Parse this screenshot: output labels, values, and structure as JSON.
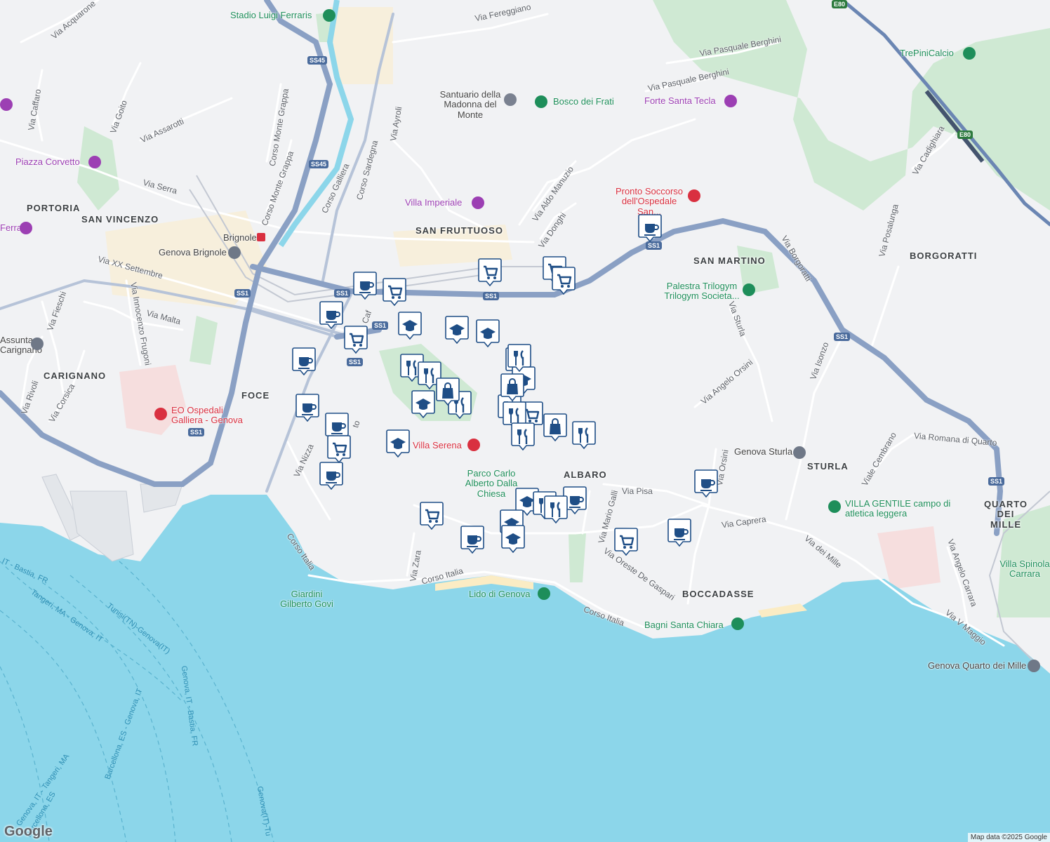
{
  "map": {
    "attribution": "Map data ©2025 Google",
    "logo": "Google",
    "colors": {
      "sea": "#8cd6ea",
      "land": "#f1f2f4",
      "park": "#c7e8cd",
      "highway": "#7f97bd",
      "road": "#ffffff",
      "pin": "#1f4e86",
      "rail": "#b9c0cc",
      "beach": "#fbecc4"
    }
  },
  "districts": [
    "PORTORIA",
    "SAN VINCENZO",
    "CARIGNANO",
    "FOCE",
    "SAN FRUTTUOSO",
    "SAN MARTINO",
    "ALBARO",
    "STURLA",
    "BORGORATTI",
    "QUARTO DEI MILLE",
    "BOCCADASSE"
  ],
  "streets": [
    "Via Acquarone",
    "Via Caffaro",
    "Via Goito",
    "Via Assarotti",
    "Corso Monte Grappa",
    "Corso Monte Grappa",
    "Via Serra",
    "Via XX Settembre",
    "Via Malta",
    "Via Fieschi",
    "Via Innocenzo Frugoni",
    "Via Rivoli",
    "Via Corsica",
    "Corso Galliera",
    "Corso Sardegna",
    "Via Ayroli",
    "Via Fereggiano",
    "Via Pasquale Berghini",
    "Via Pasquale Berghini",
    "Via Aldo Manuzio",
    "Via Donghi",
    "Via Cadighiara",
    "Via Borgoratti",
    "Via Posalunga",
    "Via Sturla",
    "Via Isonzo",
    "Via Angelo Orsini",
    "Via Romana di Quarto",
    "Viale Cembrano",
    "Via Nizza",
    "Via Pisa",
    "Via Mario Galli",
    "Via Caprera",
    "Via dei Mille",
    "Via Angelo Carrara",
    "Via V Maggio",
    "Corso Italia",
    "Corso Italia",
    "Via Oreste De Gaspari",
    "Corso Italia",
    "Via Zara",
    "Via Caf",
    "to",
    "Via Orsini"
  ],
  "pois": [
    "Stadio Luigi Ferraris",
    "Piazza Corvetto",
    "Santuario della Madonna del Monte",
    "Bosco dei Frati",
    "Forte Santa Tecla",
    "TrePiniCalcio",
    "Villa Imperiale",
    "Pronto Soccorso dell'Ospedale San...",
    "Palestra Trilogym Trilogym Societa...",
    "Genova Brignole",
    "Brignole",
    "EO Ospedali Galliera - Genova",
    "Villa Serena",
    "Parco Carlo Alberto Dalla Chiesa",
    "Genova Sturla",
    "VILLA GENTILE campo di atletica leggera",
    "Villa Spinola Carrara",
    "Lido di Genova",
    "Bagni Santa Chiara",
    "Giardini Gilberto Govi",
    "Genova Quarto dei Mille",
    "Assunta Carignano",
    "Ferrari"
  ],
  "route_labels": [
    "Tangeri, MA - Genova, IT",
    "Tunisi(TN)-Genova(IT)",
    "Genova, IT - Bastia, FR",
    "Barcellona, ES - Genova, IT",
    "Genova(IT)-Tu",
    "Genova, IT - Tangeri, MA",
    "IT - Bastia, FR",
    "Barcellona, ES"
  ],
  "road_shields": [
    "SS45",
    "SS45",
    "SS1",
    "SS1",
    "SS1",
    "SS1",
    "SS1",
    "SS1",
    "SS1",
    "SS1",
    "SS1",
    "E80",
    "E80"
  ],
  "pins": [
    {
      "kind": "cafe"
    },
    {
      "kind": "cafe"
    },
    {
      "kind": "cafe"
    },
    {
      "kind": "cafe"
    },
    {
      "kind": "cafe"
    },
    {
      "kind": "cafe"
    },
    {
      "kind": "cafe"
    },
    {
      "kind": "cafe"
    },
    {
      "kind": "cafe"
    },
    {
      "kind": "cafe"
    },
    {
      "kind": "cafe"
    },
    {
      "kind": "grocery"
    },
    {
      "kind": "grocery"
    },
    {
      "kind": "grocery"
    },
    {
      "kind": "grocery"
    },
    {
      "kind": "grocery"
    },
    {
      "kind": "grocery"
    },
    {
      "kind": "grocery"
    },
    {
      "kind": "grocery"
    },
    {
      "kind": "grocery"
    },
    {
      "kind": "grocery"
    },
    {
      "kind": "school"
    },
    {
      "kind": "school"
    },
    {
      "kind": "school"
    },
    {
      "kind": "school"
    },
    {
      "kind": "school"
    },
    {
      "kind": "school"
    },
    {
      "kind": "school"
    },
    {
      "kind": "school"
    },
    {
      "kind": "school"
    },
    {
      "kind": "restaurant"
    },
    {
      "kind": "restaurant"
    },
    {
      "kind": "restaurant"
    },
    {
      "kind": "restaurant"
    },
    {
      "kind": "restaurant"
    },
    {
      "kind": "restaurant"
    },
    {
      "kind": "restaurant"
    },
    {
      "kind": "restaurant"
    },
    {
      "kind": "restaurant"
    },
    {
      "kind": "restaurant"
    },
    {
      "kind": "shopping"
    },
    {
      "kind": "shopping"
    },
    {
      "kind": "shopping"
    }
  ]
}
